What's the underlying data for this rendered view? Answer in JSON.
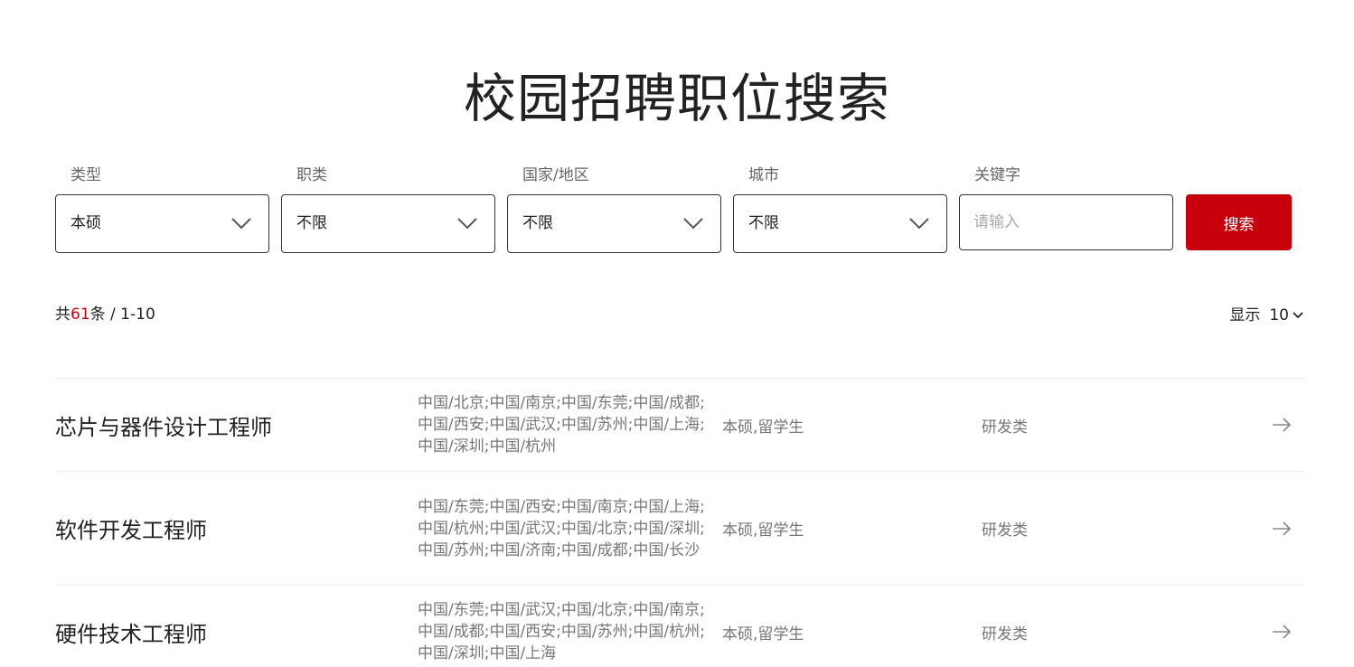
{
  "page": {
    "title": "校园招聘职位搜索"
  },
  "filters": {
    "type": {
      "label": "类型",
      "value": "本硕"
    },
    "category": {
      "label": "职类",
      "value": "不限"
    },
    "region": {
      "label": "国家/地区",
      "value": "不限"
    },
    "city": {
      "label": "城市",
      "value": "不限"
    },
    "keyword": {
      "label": "关键字",
      "placeholder": "请输入",
      "value": ""
    },
    "search_label": "搜索"
  },
  "results": {
    "prefix": "共",
    "total": "61",
    "suffix": "条 / 1-10",
    "page_size_label": "显示",
    "page_size": "10"
  },
  "jobs": [
    {
      "title": "芯片与器件设计工程师",
      "locations": "中国/北京;中国/南京;中国/东莞;中国/成都;中国/西安;中国/武汉;中国/苏州;中国/上海;中国/深圳;中国/杭州",
      "type": "本硕,留学生",
      "category": "研发类"
    },
    {
      "title": "软件开发工程师",
      "locations": "中国/东莞;中国/西安;中国/南京;中国/上海;中国/杭州;中国/武汉;中国/北京;中国/深圳;中国/苏州;中国/济南;中国/成都;中国/长沙",
      "type": "本硕,留学生",
      "category": "研发类"
    },
    {
      "title": "硬件技术工程师",
      "locations": "中国/东莞;中国/武汉;中国/北京;中国/南京;中国/成都;中国/西安;中国/苏州;中国/杭州;中国/深圳;中国/上海",
      "type": "本硕,留学生",
      "category": "研发类"
    }
  ],
  "colors": {
    "accent": "#c7000b",
    "border": "#333333",
    "muted": "#777777"
  }
}
